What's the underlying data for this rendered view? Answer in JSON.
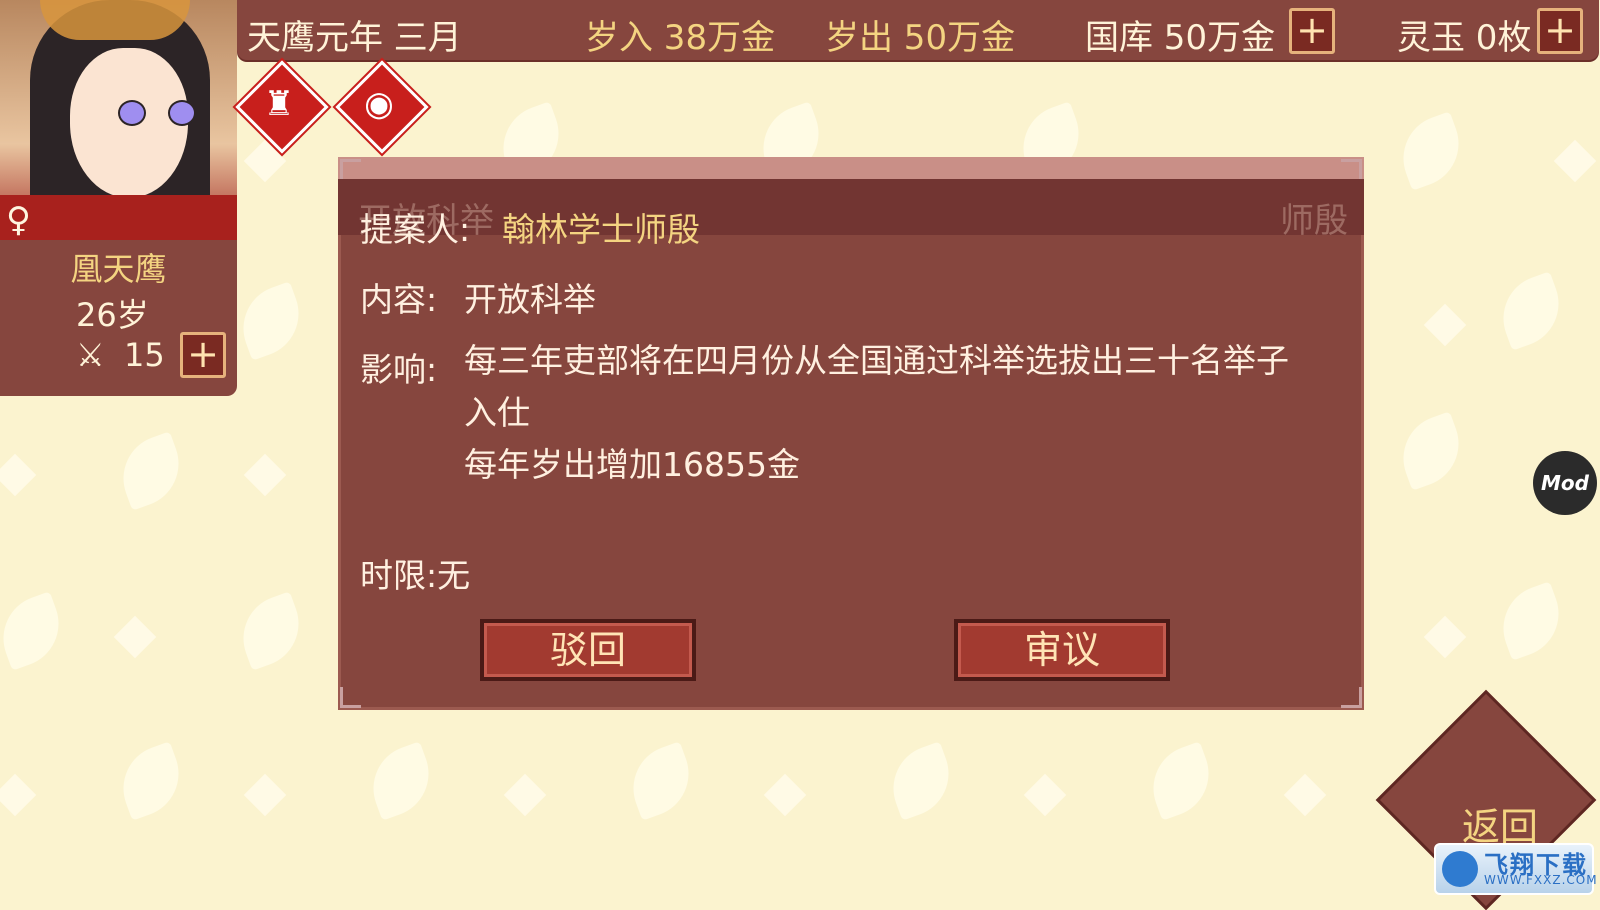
{
  "topbar": {
    "date": "天鹰元年 三月",
    "income": "岁入 38万金",
    "expense": "岁出 50万金",
    "treasury": "国库 50万金",
    "jade": "灵玉 0枚",
    "plus": "+"
  },
  "character": {
    "name": "凰天鹰",
    "age": "26岁",
    "army": "15",
    "gender_symbol": "♀",
    "plus": "+"
  },
  "status_icons": [
    "throne-icon",
    "coins-icon"
  ],
  "dialog": {
    "ghost_title": "开放科举",
    "ghost_right": "师殷",
    "proposer_label": "提案人:",
    "proposer_value": "翰林学士师殷",
    "content_label": "内容:",
    "content_value": "开放科举",
    "impact_label": "影响:",
    "impact_line1": "每三年吏部将在四月份从全国通过科举选拔出三十名举子",
    "impact_line2": "入仕",
    "impact_line3": "每年岁出增加16855金",
    "deadline": "时限:无",
    "reject_label": "驳回",
    "review_label": "审议"
  },
  "mod_badge": "Mod",
  "return_label": "返回",
  "watermark": {
    "main": "飞翔下载",
    "sub": "WWW.FXXZ.COM"
  },
  "colors": {
    "panel": "#86463e",
    "gold_text": "#f4d481",
    "background": "#fbf3cf",
    "status_red": "#c81f1c"
  }
}
